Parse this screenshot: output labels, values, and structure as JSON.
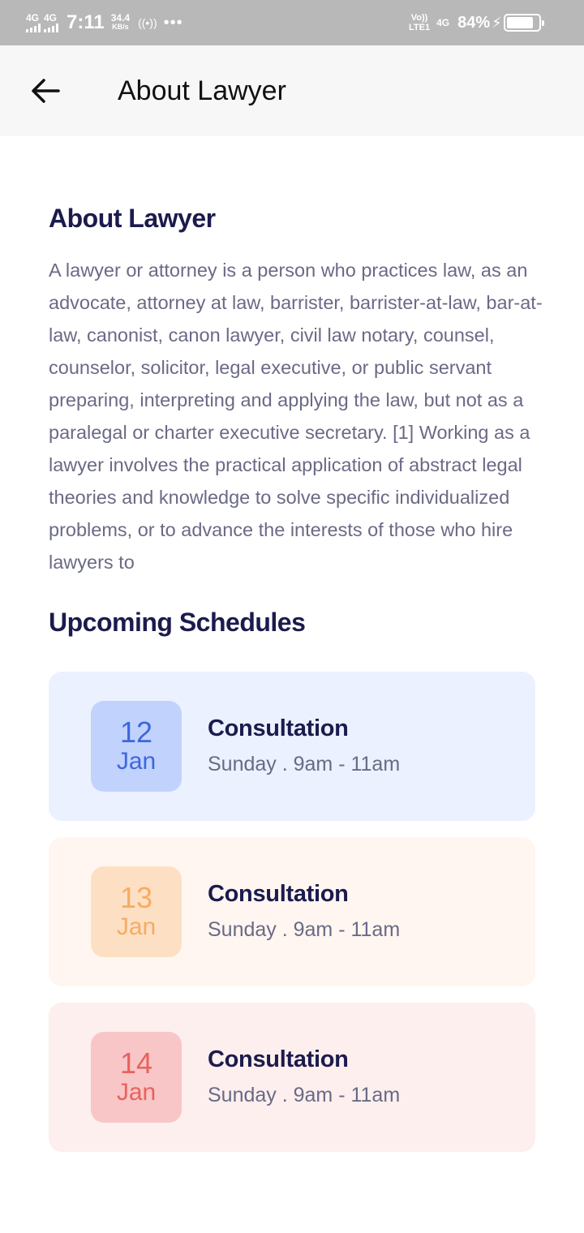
{
  "status_bar": {
    "network_1": "4G",
    "network_2": "4G",
    "time": "7:11",
    "speed_value": "34.4",
    "speed_unit": "KB/s",
    "hotspot": "((•))",
    "more": "•••",
    "volte_top": "Vo))",
    "volte_bottom": "LTE1",
    "network_3": "4G",
    "battery_percent": "84%",
    "battery_level": 0.84
  },
  "app_bar": {
    "title": "About Lawyer",
    "back_icon": "arrow-left-icon"
  },
  "about": {
    "heading": "About Lawyer",
    "text": "A lawyer or attorney is a person who practices law, as an advocate, attorney at law, barrister, barrister-at-law, bar-at-law, canonist, canon lawyer, civil law notary, counsel, counselor, solicitor, legal executive, or public servant preparing, interpreting and applying the law, but not as a paralegal or charter executive secretary. [1] Working as a lawyer involves the practical application of abstract legal theories and knowledge to solve specific individualized problems, or to advance the interests of those who hire lawyers to"
  },
  "schedules": {
    "heading": "Upcoming Schedules",
    "items": [
      {
        "day": "12",
        "month": "Jan",
        "title": "Consultation",
        "time": "Sunday . 9am - 11am",
        "card_bg": "#ebf1fe",
        "box_bg": "#c1d2fd",
        "accent": "#3e67dd"
      },
      {
        "day": "13",
        "month": "Jan",
        "title": "Consultation",
        "time": "Sunday . 9am - 11am",
        "card_bg": "#fff6f1",
        "box_bg": "#fde0c4",
        "accent": "#f7ab62"
      },
      {
        "day": "14",
        "month": "Jan",
        "title": "Consultation",
        "time": "Sunday . 9am - 11am",
        "card_bg": "#fcefee",
        "box_bg": "#f8c6c6",
        "accent": "#e8625e"
      }
    ]
  },
  "colors": {
    "heading": "#1c1b4d",
    "body_text": "#6a6a86",
    "status_bar": "#b8b8b8",
    "app_bar": "#f7f7f7"
  }
}
